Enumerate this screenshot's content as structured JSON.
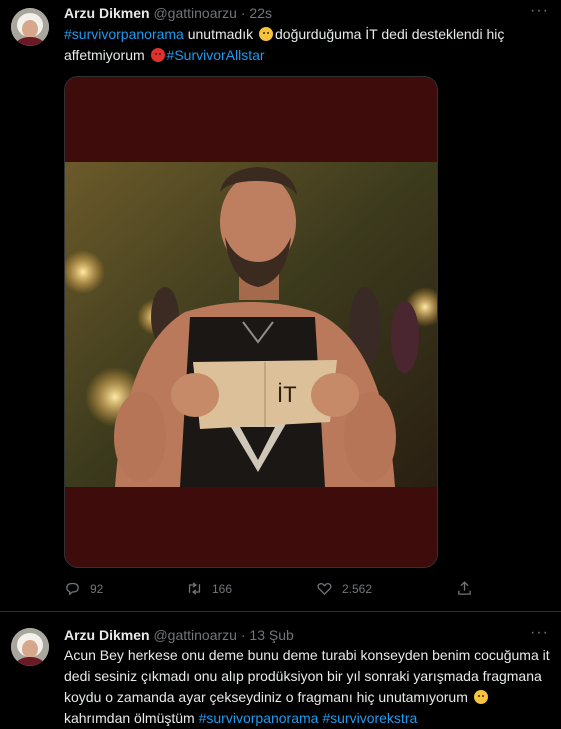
{
  "tweets": [
    {
      "author_name": "Arzu Dikmen",
      "handle": "@gattinoarzu",
      "separator": "·",
      "time": "22s",
      "text": {
        "hashtag1": "#survivorpanorama",
        "part1": " unutmadık ",
        "emoji1": "sad-face",
        "part2": "doğurduğuma  İT dedi desteklendi hiç affetmiyorum ",
        "emoji2": "angry-face",
        "hashtag2": "#SurvivorAllstar"
      },
      "media": {
        "sign_text": "İT"
      },
      "stats": {
        "replies": "92",
        "retweets": "166",
        "likes": "2.562"
      }
    },
    {
      "author_name": "Arzu Dikmen",
      "handle": "@gattinoarzu",
      "separator": "·",
      "time": "13 Şub",
      "text": {
        "part1": "Acun Bey herkese onu deme bunu deme turabi konseyden benim cocuğuma it dedi sesiniz çıkmadı onu alıp prodüksiyon bir yıl sonraki yarışmada fragmana koydu  o zamanda ayar çekseydiniz o fragmanı hiç unutamıyorum ",
        "emoji1": "sad-face",
        "part2": "kahrımdan ölmüştüm ",
        "hashtag1": "#survivorpanorama",
        "hashtag2": "#survivorekstra"
      }
    }
  ],
  "colors": {
    "background": "#000000",
    "text": "#e7e9ea",
    "muted": "#71767b",
    "link": "#1d9bf0"
  }
}
